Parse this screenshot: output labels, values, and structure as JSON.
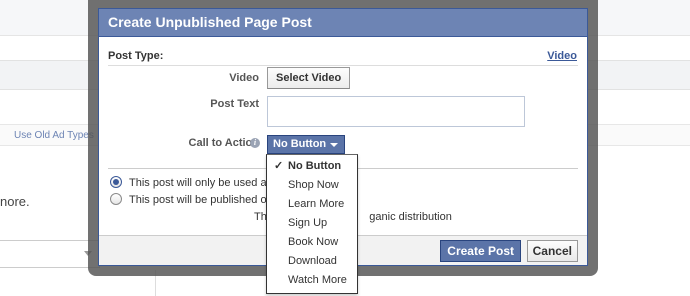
{
  "background": {
    "link_text": "Use Old Ad Types",
    "partial_text": "nore."
  },
  "dialog": {
    "title": "Create Unpublished Page Post",
    "post_type_label": "Post Type:",
    "post_type_link": "Video",
    "video_label": "Video",
    "select_video_button": "Select Video",
    "post_text_label": "Post Text",
    "post_text_value": "",
    "cta_label": "Call to Action",
    "info_icon": "i",
    "cta_selected": "No Button",
    "radio_option_1": "This post will only be used as",
    "radio_option_2": "This post will be published o",
    "note_text": "Thi                                  ganic distribution",
    "create_button": "Create Post",
    "cancel_button": "Cancel"
  },
  "cta_menu": {
    "items": [
      {
        "label": "No Button",
        "check": "✓"
      },
      {
        "label": "Shop Now"
      },
      {
        "label": "Learn More"
      },
      {
        "label": "Sign Up"
      },
      {
        "label": "Book Now"
      },
      {
        "label": "Download"
      },
      {
        "label": "Watch More"
      }
    ]
  },
  "colors": {
    "title_bar": "#6d84b4",
    "primary_button": "#5b74a8",
    "border_blue": "#3b5998"
  }
}
